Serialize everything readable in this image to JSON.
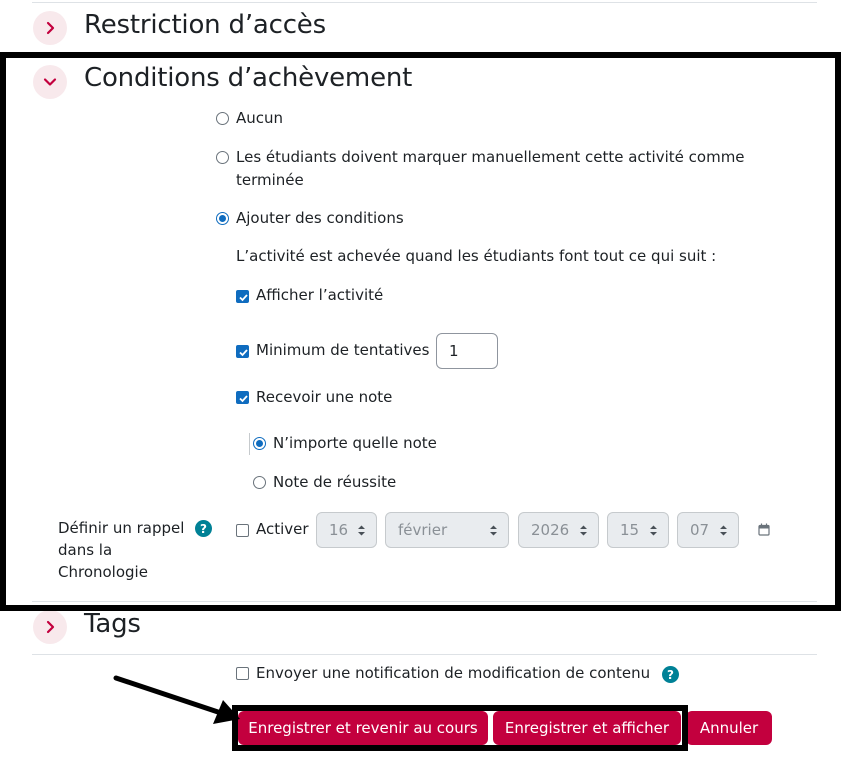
{
  "sections": {
    "restriction": {
      "title": "Restriction d’accès"
    },
    "completion": {
      "title": "Conditions d’achèvement"
    },
    "tags": {
      "title": "Tags"
    }
  },
  "completion": {
    "options": [
      {
        "label": "Aucun",
        "selected": false
      },
      {
        "label": "Les étudiants doivent marquer manuellement cette activité comme terminée",
        "selected": false
      },
      {
        "label": "Ajouter des conditions",
        "selected": true
      }
    ],
    "intro": "L’activité est achevée quand les étudiants font tout ce qui suit :",
    "conditions": {
      "view": {
        "label": "Afficher l’activité",
        "checked": true
      },
      "attempts": {
        "label": "Minimum de tentatives",
        "checked": true,
        "value": "1"
      },
      "grade": {
        "label": "Recevoir une note",
        "checked": true
      }
    },
    "grade_options": [
      {
        "label": "N’importe quelle note",
        "selected": true
      },
      {
        "label": "Note de réussite",
        "selected": false
      }
    ],
    "reminder": {
      "label": "Définir un rappel dans la Chronologie",
      "enable_label": "Activer",
      "enabled": false,
      "day": "16",
      "month": "février",
      "year": "2026",
      "hour": "15",
      "minute": "07"
    }
  },
  "notify": {
    "label": "Envoyer une notification de modification de contenu",
    "checked": false
  },
  "buttons": {
    "save_return": "Enregistrer et revenir au cours",
    "save_display": "Enregistrer et afficher",
    "cancel": "Annuler"
  },
  "colors": {
    "primary": "#c3003e",
    "toggle_bg": "#f8e9ec",
    "checkbox": "#0f6cbf",
    "help": "#008196"
  },
  "icons": {
    "collapsed": "chevron-right-icon",
    "expanded": "chevron-down-icon",
    "calendar": "calendar-icon",
    "help": "question-circle-icon",
    "annotation": "arrow-icon"
  }
}
